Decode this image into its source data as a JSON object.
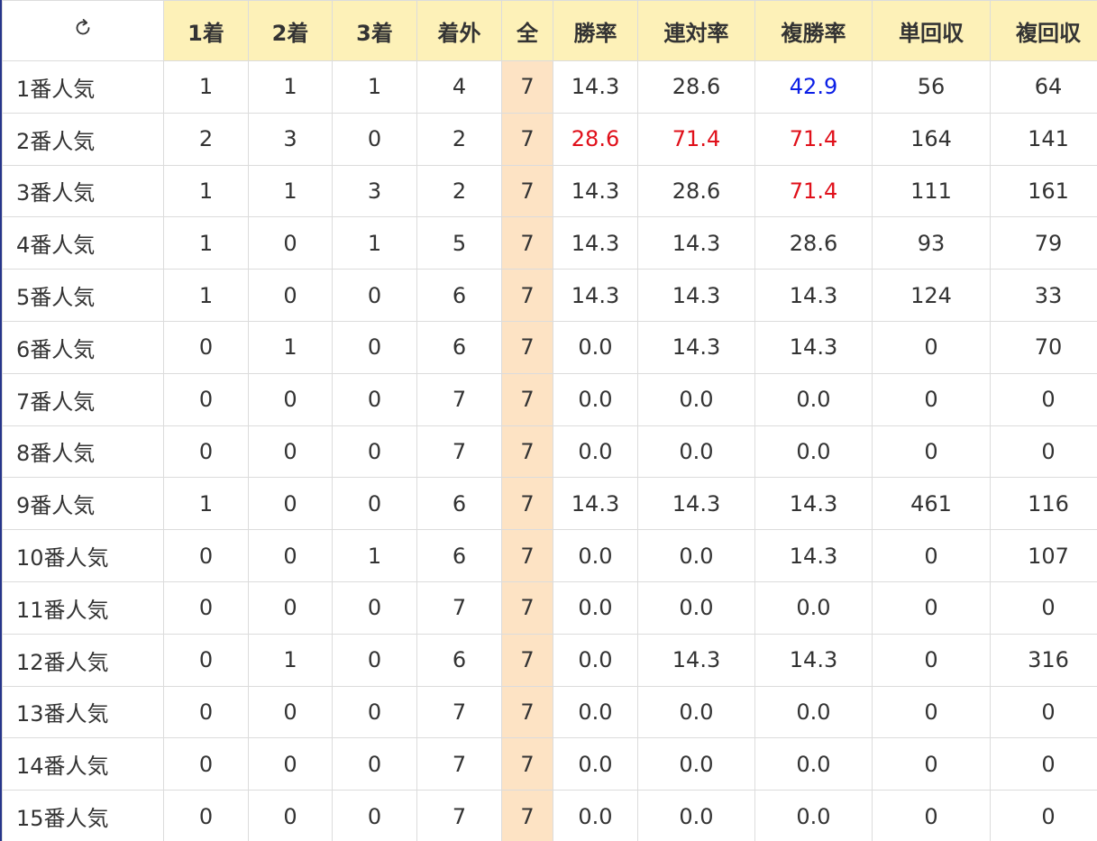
{
  "header": {
    "refresh_icon": "refresh-icon",
    "columns": [
      "1着",
      "2着",
      "3着",
      "着外",
      "全",
      "勝率",
      "連対率",
      "複勝率",
      "単回収",
      "複回収"
    ]
  },
  "colors": {
    "header_bg": "#fdf1b8",
    "total_column_bg": "#fde3c4",
    "highlight_red": "#e0101a",
    "highlight_blue": "#0a1ee6",
    "text": "#333333"
  },
  "rows": [
    {
      "label": "1番人気",
      "values": [
        "1",
        "1",
        "1",
        "4",
        "7",
        "14.3",
        "28.6",
        "42.9",
        "56",
        "64"
      ],
      "highlights": {
        "7": "blue"
      }
    },
    {
      "label": "2番人気",
      "values": [
        "2",
        "3",
        "0",
        "2",
        "7",
        "28.6",
        "71.4",
        "71.4",
        "164",
        "141"
      ],
      "highlights": {
        "5": "red",
        "6": "red",
        "7": "red"
      }
    },
    {
      "label": "3番人気",
      "values": [
        "1",
        "1",
        "3",
        "2",
        "7",
        "14.3",
        "28.6",
        "71.4",
        "111",
        "161"
      ],
      "highlights": {
        "7": "red"
      }
    },
    {
      "label": "4番人気",
      "values": [
        "1",
        "0",
        "1",
        "5",
        "7",
        "14.3",
        "14.3",
        "28.6",
        "93",
        "79"
      ],
      "highlights": {}
    },
    {
      "label": "5番人気",
      "values": [
        "1",
        "0",
        "0",
        "6",
        "7",
        "14.3",
        "14.3",
        "14.3",
        "124",
        "33"
      ],
      "highlights": {}
    },
    {
      "label": "6番人気",
      "values": [
        "0",
        "1",
        "0",
        "6",
        "7",
        "0.0",
        "14.3",
        "14.3",
        "0",
        "70"
      ],
      "highlights": {}
    },
    {
      "label": "7番人気",
      "values": [
        "0",
        "0",
        "0",
        "7",
        "7",
        "0.0",
        "0.0",
        "0.0",
        "0",
        "0"
      ],
      "highlights": {}
    },
    {
      "label": "8番人気",
      "values": [
        "0",
        "0",
        "0",
        "7",
        "7",
        "0.0",
        "0.0",
        "0.0",
        "0",
        "0"
      ],
      "highlights": {}
    },
    {
      "label": "9番人気",
      "values": [
        "1",
        "0",
        "0",
        "6",
        "7",
        "14.3",
        "14.3",
        "14.3",
        "461",
        "116"
      ],
      "highlights": {}
    },
    {
      "label": "10番人気",
      "values": [
        "0",
        "0",
        "1",
        "6",
        "7",
        "0.0",
        "0.0",
        "14.3",
        "0",
        "107"
      ],
      "highlights": {}
    },
    {
      "label": "11番人気",
      "values": [
        "0",
        "0",
        "0",
        "7",
        "7",
        "0.0",
        "0.0",
        "0.0",
        "0",
        "0"
      ],
      "highlights": {}
    },
    {
      "label": "12番人気",
      "values": [
        "0",
        "1",
        "0",
        "6",
        "7",
        "0.0",
        "14.3",
        "14.3",
        "0",
        "316"
      ],
      "highlights": {}
    },
    {
      "label": "13番人気",
      "values": [
        "0",
        "0",
        "0",
        "7",
        "7",
        "0.0",
        "0.0",
        "0.0",
        "0",
        "0"
      ],
      "highlights": {}
    },
    {
      "label": "14番人気",
      "values": [
        "0",
        "0",
        "0",
        "7",
        "7",
        "0.0",
        "0.0",
        "0.0",
        "0",
        "0"
      ],
      "highlights": {}
    },
    {
      "label": "15番人気",
      "values": [
        "0",
        "0",
        "0",
        "7",
        "7",
        "0.0",
        "0.0",
        "0.0",
        "0",
        "0"
      ],
      "highlights": {}
    }
  ]
}
